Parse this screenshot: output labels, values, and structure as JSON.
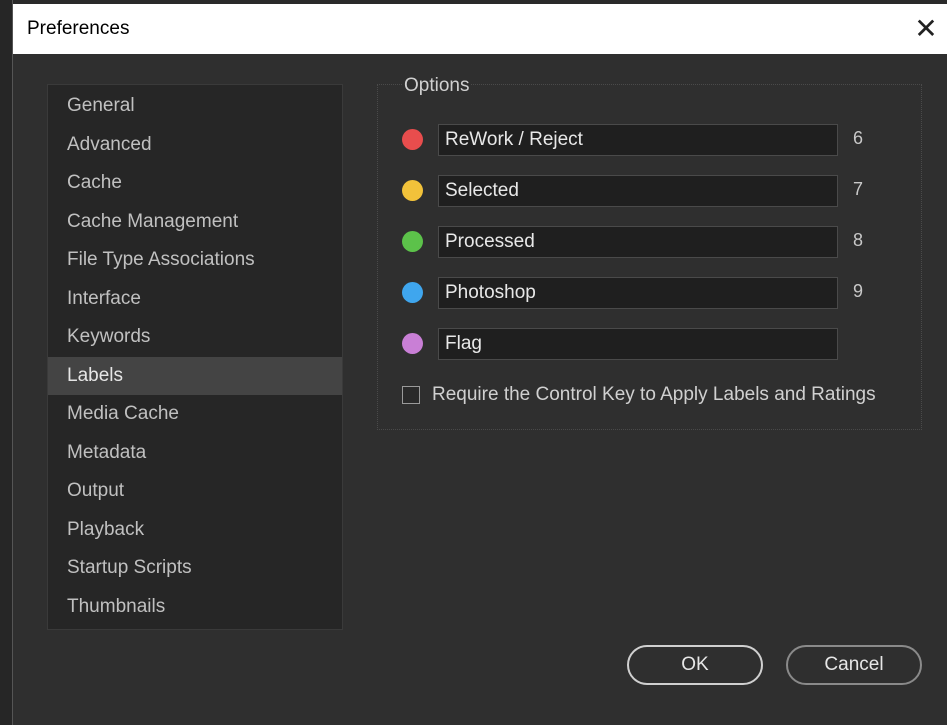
{
  "window": {
    "title": "Preferences",
    "close_glyph": "✕"
  },
  "sidebar": {
    "items": [
      {
        "label": "General"
      },
      {
        "label": "Advanced"
      },
      {
        "label": "Cache"
      },
      {
        "label": "Cache Management"
      },
      {
        "label": "File Type Associations"
      },
      {
        "label": "Interface"
      },
      {
        "label": "Keywords"
      },
      {
        "label": "Labels",
        "selected": true
      },
      {
        "label": "Media Cache"
      },
      {
        "label": "Metadata"
      },
      {
        "label": "Output"
      },
      {
        "label": "Playback"
      },
      {
        "label": "Startup Scripts"
      },
      {
        "label": "Thumbnails"
      }
    ]
  },
  "options": {
    "title": "Options",
    "labels": [
      {
        "value": "ReWork / Reject",
        "color": "#e84d4d",
        "shortcut": "6"
      },
      {
        "value": "Selected",
        "color": "#f2c23a",
        "shortcut": "7"
      },
      {
        "value": "Processed",
        "color": "#5cc24a",
        "shortcut": "8"
      },
      {
        "value": "Photoshop",
        "color": "#3fa6ee",
        "shortcut": "9"
      },
      {
        "value": "Flag",
        "color": "#c97fd6",
        "shortcut": ""
      }
    ],
    "checkbox": {
      "label": "Require the Control Key to Apply Labels and Ratings",
      "checked": false
    }
  },
  "buttons": {
    "ok_label": "OK",
    "cancel_label": "Cancel"
  }
}
